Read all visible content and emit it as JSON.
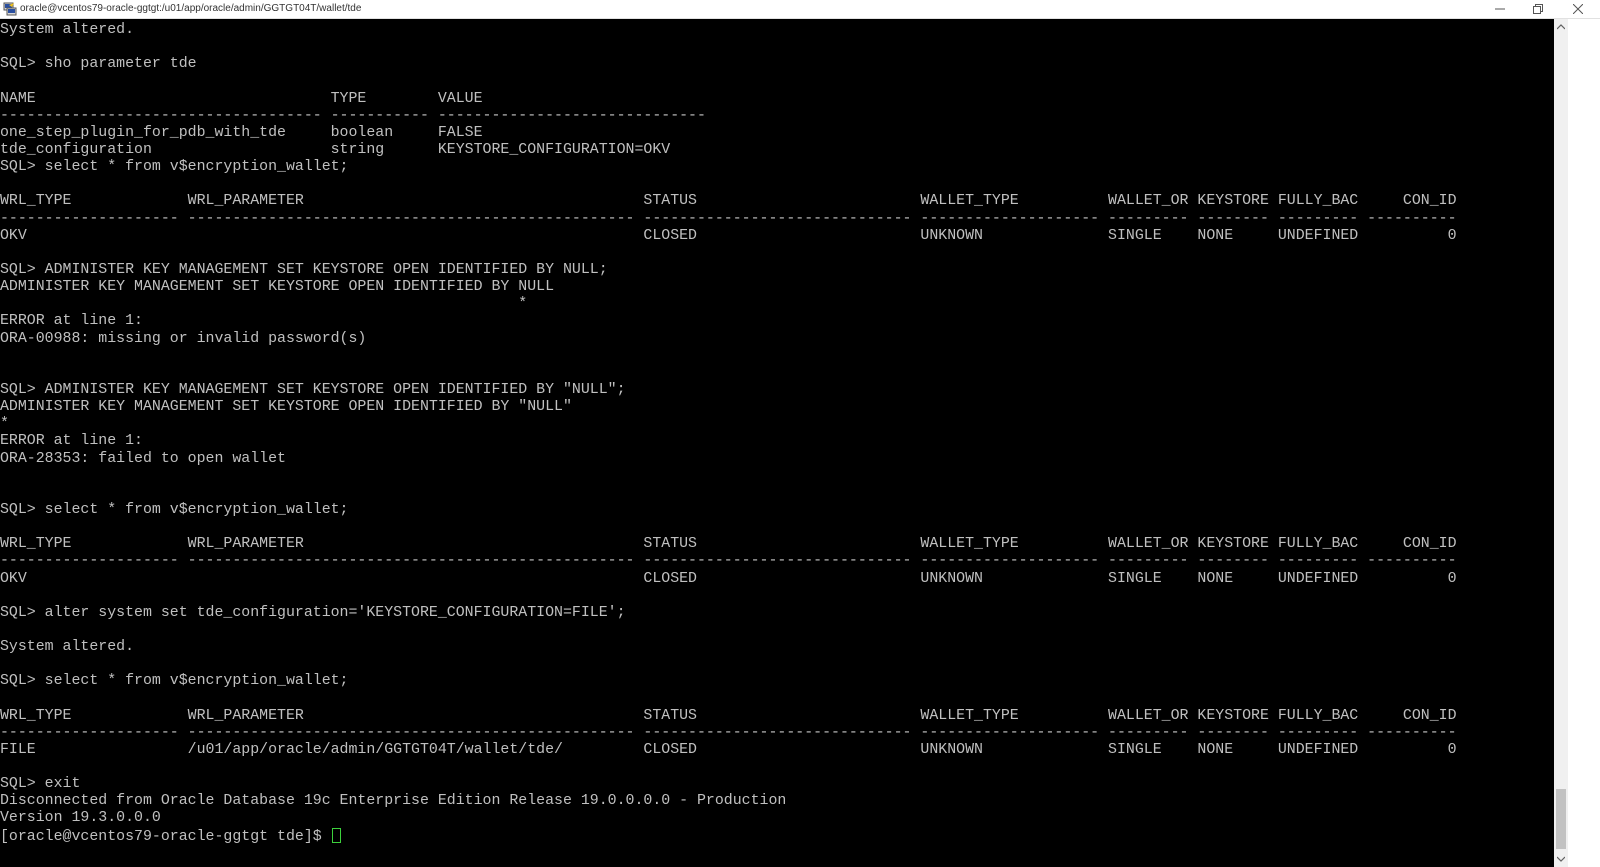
{
  "window": {
    "title": "oracle@vcentos79-oracle-ggtgt:/u01/app/oracle/admin/GGTGT04T/wallet/tde",
    "app_icon": "putty-icon",
    "controls": {
      "minimize": "minimize-icon",
      "maximize": "restore-icon",
      "close": "close-icon"
    }
  },
  "terminal": {
    "colors": {
      "background": "#000000",
      "foreground": "#c0c0c0",
      "cursor": "#3cd13c"
    },
    "lines": [
      "System altered.",
      "",
      "SQL> sho parameter tde",
      "",
      "NAME                                 TYPE        VALUE",
      "------------------------------------ ----------- ------------------------------",
      "one_step_plugin_for_pdb_with_tde     boolean     FALSE",
      "tde_configuration                    string      KEYSTORE_CONFIGURATION=OKV",
      "SQL> select * from v$encryption_wallet;",
      "",
      "WRL_TYPE             WRL_PARAMETER                                      STATUS                         WALLET_TYPE          WALLET_OR KEYSTORE FULLY_BAC     CON_ID",
      "-------------------- -------------------------------------------------- ------------------------------ -------------------- --------- -------- --------- ----------",
      "OKV                                                                     CLOSED                         UNKNOWN              SINGLE    NONE     UNDEFINED          0",
      "",
      "SQL> ADMINISTER KEY MANAGEMENT SET KEYSTORE OPEN IDENTIFIED BY NULL;",
      "ADMINISTER KEY MANAGEMENT SET KEYSTORE OPEN IDENTIFIED BY NULL",
      "                                                          *",
      "ERROR at line 1:",
      "ORA-00988: missing or invalid password(s)",
      "",
      "",
      "SQL> ADMINISTER KEY MANAGEMENT SET KEYSTORE OPEN IDENTIFIED BY \"NULL\";",
      "ADMINISTER KEY MANAGEMENT SET KEYSTORE OPEN IDENTIFIED BY \"NULL\"",
      "*",
      "ERROR at line 1:",
      "ORA-28353: failed to open wallet",
      "",
      "",
      "SQL> select * from v$encryption_wallet;",
      "",
      "WRL_TYPE             WRL_PARAMETER                                      STATUS                         WALLET_TYPE          WALLET_OR KEYSTORE FULLY_BAC     CON_ID",
      "-------------------- -------------------------------------------------- ------------------------------ -------------------- --------- -------- --------- ----------",
      "OKV                                                                     CLOSED                         UNKNOWN              SINGLE    NONE     UNDEFINED          0",
      "",
      "SQL> alter system set tde_configuration='KEYSTORE_CONFIGURATION=FILE';",
      "",
      "System altered.",
      "",
      "SQL> select * from v$encryption_wallet;",
      "",
      "WRL_TYPE             WRL_PARAMETER                                      STATUS                         WALLET_TYPE          WALLET_OR KEYSTORE FULLY_BAC     CON_ID",
      "-------------------- -------------------------------------------------- ------------------------------ -------------------- --------- -------- --------- ----------",
      "FILE                 /u01/app/oracle/admin/GGTGT04T/wallet/tde/         CLOSED                         UNKNOWN              SINGLE    NONE     UNDEFINED          0",
      "",
      "SQL> exit",
      "Disconnected from Oracle Database 19c Enterprise Edition Release 19.0.0.0.0 - Production",
      "Version 19.3.0.0.0"
    ],
    "prompt": "[oracle@vcentos79-oracle-ggtgt tde]$ "
  }
}
